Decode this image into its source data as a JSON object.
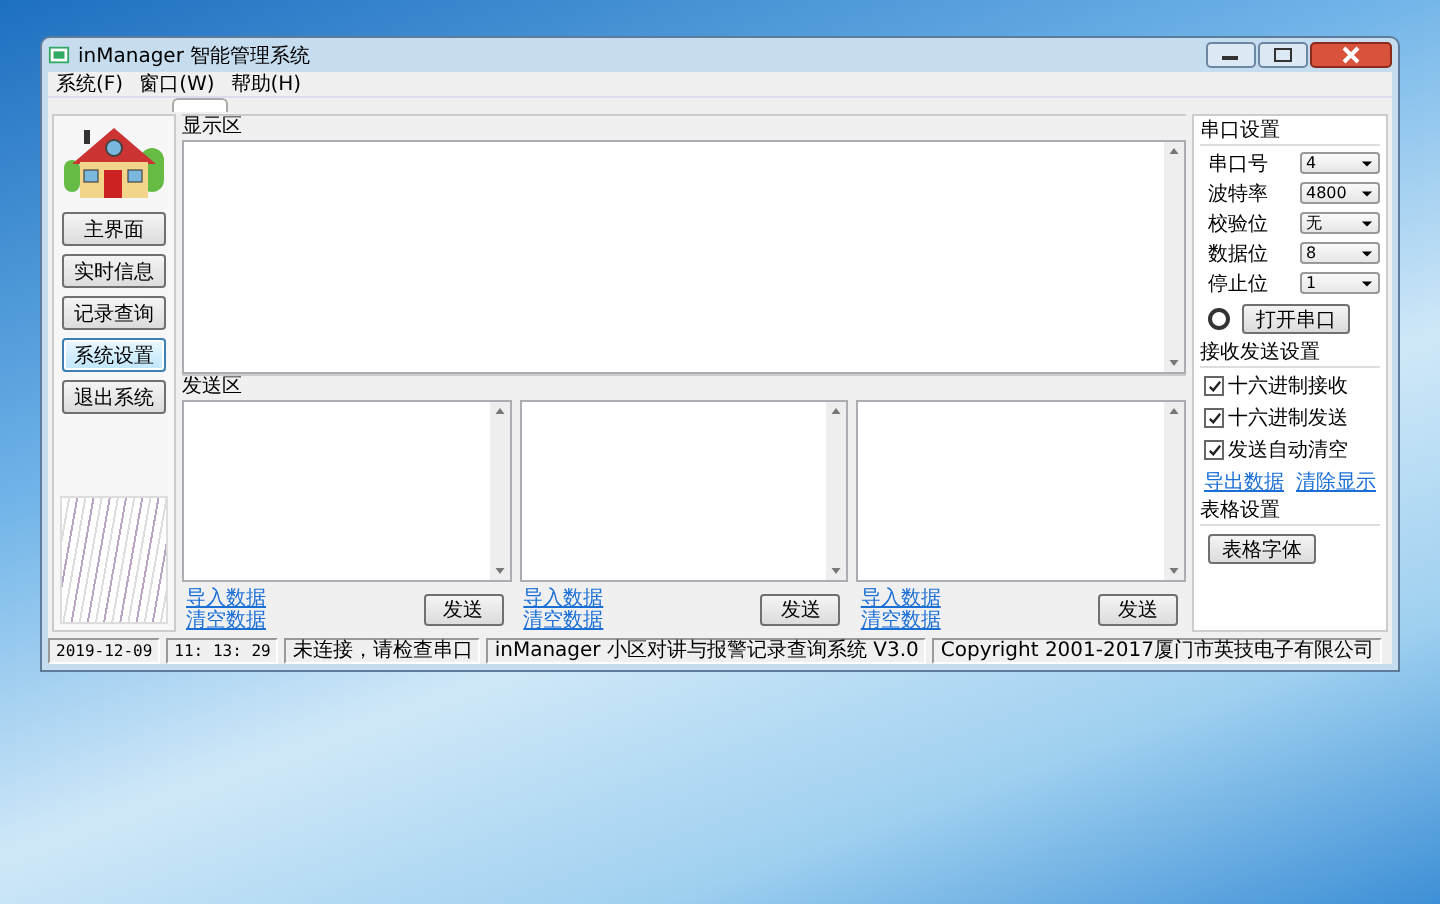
{
  "window": {
    "title": "inManager 智能管理系统"
  },
  "menu": [
    {
      "label": "系统(F)"
    },
    {
      "label": "窗口(W)"
    },
    {
      "label": "帮助(H)"
    }
  ],
  "sidebar": {
    "buttons": [
      {
        "label": "主界面",
        "selected": false
      },
      {
        "label": "实时信息",
        "selected": false
      },
      {
        "label": "记录查询",
        "selected": false
      },
      {
        "label": "系统设置",
        "selected": true
      },
      {
        "label": "退出系统",
        "selected": false
      }
    ]
  },
  "display_area": {
    "label": "显示区"
  },
  "send_area": {
    "label": "发送区",
    "panes": [
      {
        "import_link": "导入数据",
        "clear_link": "清空数据",
        "send_button": "发送"
      },
      {
        "import_link": "导入数据",
        "clear_link": "清空数据",
        "send_button": "发送"
      },
      {
        "import_link": "导入数据",
        "clear_link": "清空数据",
        "send_button": "发送"
      }
    ]
  },
  "serial_settings": {
    "title": "串口设置",
    "fields": [
      {
        "label": "串口号",
        "value": "4"
      },
      {
        "label": "波特率",
        "value": "4800"
      },
      {
        "label": "校验位",
        "value": "无"
      },
      {
        "label": "数据位",
        "value": "8"
      },
      {
        "label": "停止位",
        "value": "1"
      }
    ],
    "connected": false,
    "open_button": "打开串口"
  },
  "transceive_settings": {
    "title": "接收发送设置",
    "options": [
      {
        "label": "十六进制接收",
        "checked": true
      },
      {
        "label": "十六进制发送",
        "checked": true
      },
      {
        "label": "发送自动清空",
        "checked": true
      }
    ],
    "links": [
      "导出数据",
      "清除显示"
    ]
  },
  "table_settings": {
    "title": "表格设置",
    "font_button": "表格字体"
  },
  "status_bar": [
    "2019-12-09",
    "11: 13: 29",
    "未连接，请检查串口",
    "inManager 小区对讲与报警记录查询系统 V3.0",
    "Copyright 2001-2017厦门市英技电子有限公司"
  ]
}
